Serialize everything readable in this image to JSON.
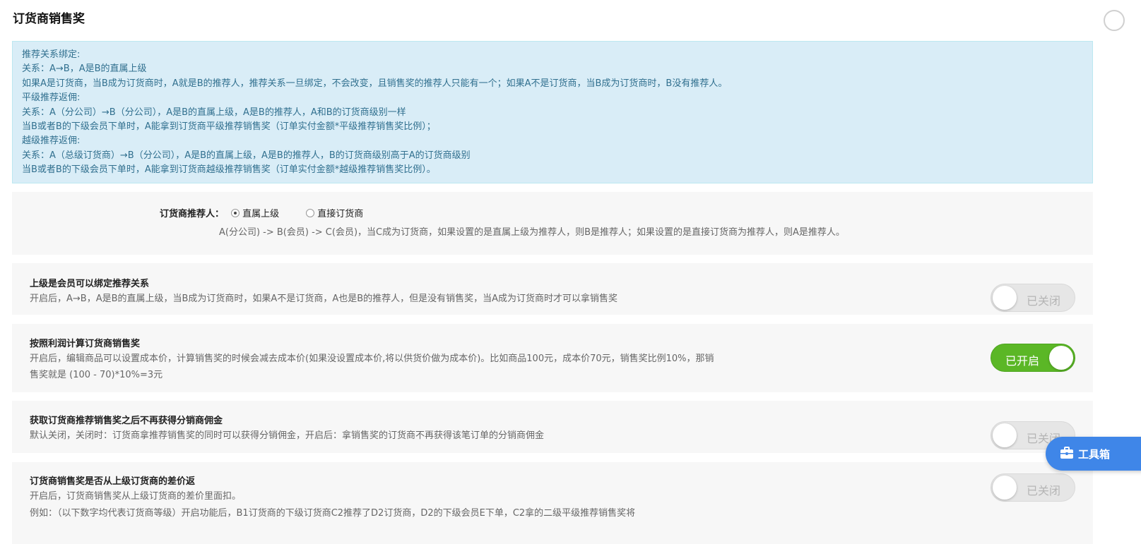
{
  "page": {
    "title": "订货商销售奖"
  },
  "info": {
    "lines": [
      "推荐关系绑定:",
      "关系：A→B，A是B的直属上级",
      "如果A是订货商，当B成为订货商时，A就是B的推荐人，推荐关系一旦绑定，不会改变，且销售奖的推荐人只能有一个；如果A不是订货商，当B成为订货商时，B没有推荐人。",
      "平级推荐返佣:",
      "关系：A（分公司）→B（分公司），A是B的直属上级，A是B的推荐人，A和B的订货商级别一样",
      "当B或者B的下级会员下单时，A能拿到订货商平级推荐销售奖（订单实付金额*平级推荐销售奖比例）；",
      "越级推荐返佣:",
      "关系：A（总级订货商）→B（分公司），A是B的直属上级，A是B的推荐人，B的订货商级别高于A的订货商级别",
      "当B或者B的下级会员下单时，A能拿到订货商越级推荐销售奖（订单实付金额*越级推荐销售奖比例）。"
    ]
  },
  "recommender": {
    "label": "订货商推荐人：",
    "options": [
      {
        "label": "直属上级",
        "selected": true
      },
      {
        "label": "直接订货商",
        "selected": false
      }
    ],
    "description": "A(分公司) -> B(会员) -> C(会员)，当C成为订货商，如果设置的是直属上级为推荐人，则B是推荐人；如果设置的是直接订货商为推荐人，则A是推荐人。"
  },
  "settings": [
    {
      "title": "上级是会员可以绑定推荐关系",
      "desc": "开启后，A→B，A是B的直属上级，当B成为订货商时，如果A不是订货商，A也是B的推荐人，但是没有销售奖，当A成为订货商时才可以拿销售奖",
      "toggle": "已关闭",
      "on": false
    },
    {
      "title": "按照利润计算订货商销售奖",
      "desc": "开启后，编辑商品可以设置成本价，计算销售奖的时候会减去成本价(如果没设置成本价,将以供货价做为成本价)。比如商品100元，成本价70元，销售奖比例10%，那销售奖就是 (100 - 70)*10%=3元",
      "toggle": "已开启",
      "on": true
    },
    {
      "title": "获取订货商推荐销售奖之后不再获得分销商佣金",
      "desc": "默认关闭，关闭时：订货商拿推荐销售奖的同时可以获得分销佣金，开启后：拿销售奖的订货商不再获得该笔订单的分销商佣金",
      "toggle": "已关闭",
      "on": false
    },
    {
      "title": "订货商销售奖是否从上级订货商的差价返",
      "desc": "开启后，订货商销售奖从上级订货商的差价里面扣。",
      "desc2": "例如：（以下数字均代表订货商等级）开启功能后，B1订货商的下级订货商C2推荐了D2订货商，D2的下级会员E下单，C2拿的二级平级推荐销售奖将",
      "toggle": "已关闭",
      "on": false
    }
  ],
  "toolbox": {
    "label": "工具箱"
  },
  "colors": {
    "info_bg": "#d9edf7",
    "info_text": "#31708f",
    "toggle_on": "#5bb726",
    "toolbox": "#3f86e8"
  }
}
